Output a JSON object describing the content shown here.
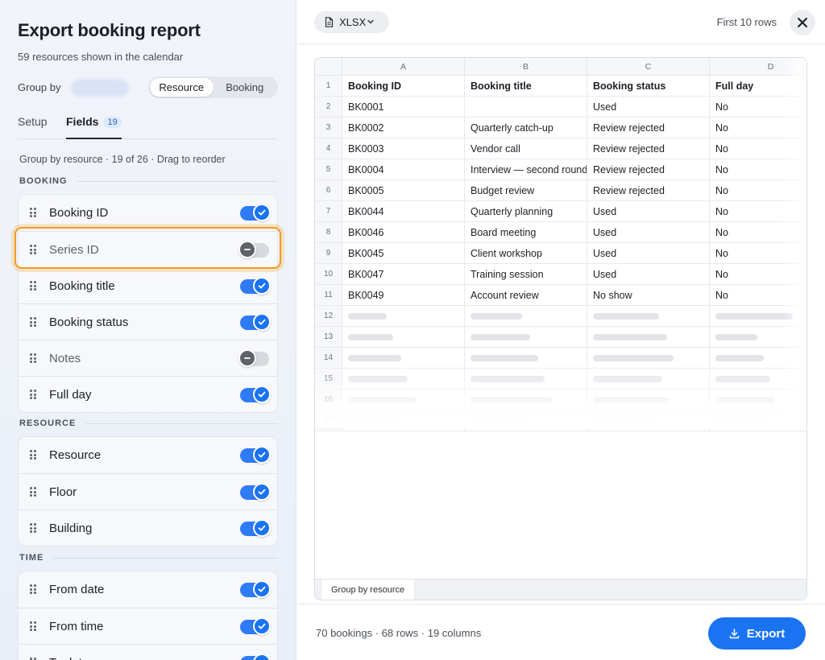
{
  "panel": {
    "title": "Export booking report",
    "subtitle": "59 resources shown in the calendar",
    "group_by_label": "Group by",
    "group_options": [
      "Resource",
      "Booking"
    ],
    "group_selected": "Resource",
    "tabs": {
      "setup": "Setup",
      "fields": "Fields",
      "fields_count": "19"
    },
    "hint": "Group by resource · 19 of 26 · Drag to reorder",
    "sections": [
      {
        "label": "BOOKING",
        "fields": [
          {
            "label": "Booking ID",
            "enabled": true
          },
          {
            "label": "Series ID",
            "enabled": false,
            "focused": true
          },
          {
            "label": "Booking title",
            "enabled": true
          },
          {
            "label": "Booking status",
            "enabled": true
          },
          {
            "label": "Notes",
            "enabled": false
          },
          {
            "label": "Full day",
            "enabled": true
          }
        ]
      },
      {
        "label": "RESOURCE",
        "fields": [
          {
            "label": "Resource",
            "enabled": true
          },
          {
            "label": "Floor",
            "enabled": true
          },
          {
            "label": "Building",
            "enabled": true
          }
        ]
      },
      {
        "label": "TIME",
        "fields": [
          {
            "label": "From date",
            "enabled": true
          },
          {
            "label": "From time",
            "enabled": true
          },
          {
            "label": "To date",
            "enabled": true
          }
        ]
      }
    ]
  },
  "preview": {
    "format": "XLSX",
    "rows_note": "First 10 rows",
    "columns": [
      "A",
      "B",
      "C",
      "D"
    ],
    "headers": [
      "Booking ID",
      "Booking title",
      "Booking status",
      "Full day"
    ],
    "rows": [
      [
        "BK0001",
        "",
        "Used",
        "No"
      ],
      [
        "BK0002",
        "Quarterly catch-up",
        "Review rejected",
        "No"
      ],
      [
        "BK0003",
        "Vendor call",
        "Review rejected",
        "No"
      ],
      [
        "BK0004",
        "Interview — second round",
        "Review rejected",
        "No"
      ],
      [
        "BK0005",
        "Budget review",
        "Review rejected",
        "No"
      ],
      [
        "BK0044",
        "Quarterly planning",
        "Used",
        "No"
      ],
      [
        "BK0046",
        "Board meeting",
        "Used",
        "No"
      ],
      [
        "BK0045",
        "Client workshop",
        "Used",
        "No"
      ],
      [
        "BK0047",
        "Training session",
        "Used",
        "No"
      ],
      [
        "BK0049",
        "Account review",
        "No show",
        "No"
      ]
    ],
    "row_numbers": [
      "1",
      "2",
      "3",
      "4",
      "5",
      "6",
      "7",
      "8",
      "9",
      "10",
      "11",
      "12",
      "13",
      "14",
      "15",
      "16",
      "17"
    ],
    "sheet_tab": "Group by resource"
  },
  "footer": {
    "summary": "70 bookings · 68 rows · 19 columns",
    "export_label": "Export"
  },
  "colors": {
    "accent": "#1a73f0",
    "focus": "#f29a1c"
  }
}
